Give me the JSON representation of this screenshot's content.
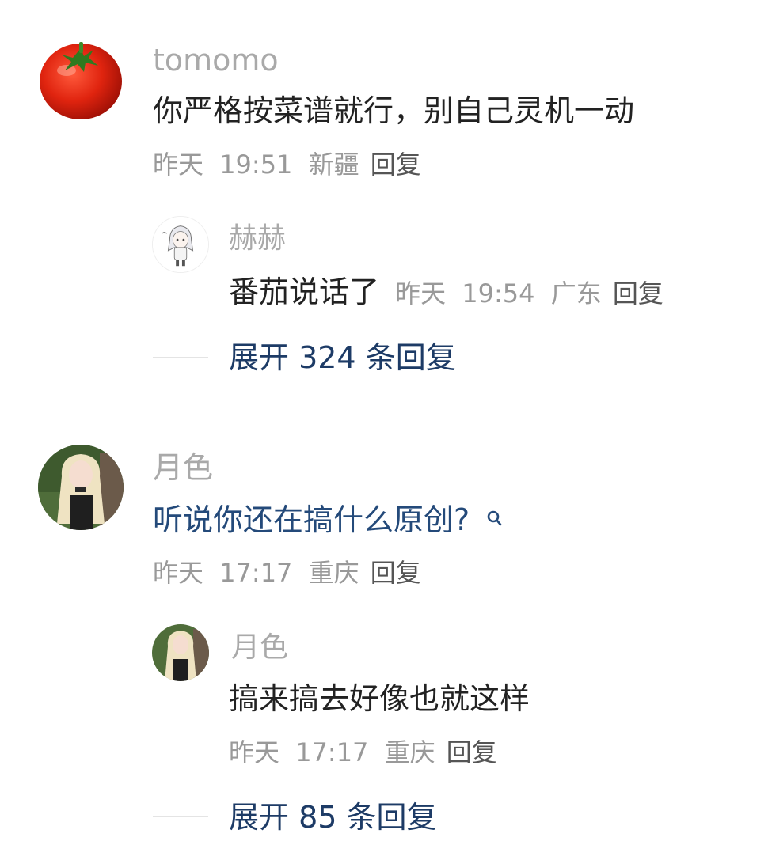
{
  "comments": [
    {
      "user": "tomomo",
      "text": "你严格按菜谱就行，别自己灵机一动",
      "date": "昨天",
      "time": "19:51",
      "location": "新疆",
      "reply_label": "回复",
      "replies": [
        {
          "user": "赫赫",
          "text": "番茄说话了",
          "date": "昨天",
          "time": "19:54",
          "location": "广东",
          "reply_label": "回复"
        }
      ],
      "expand": "展开 324 条回复"
    },
    {
      "user": "月色",
      "text": "听说你还在搞什么原创?",
      "search_icon": "search-icon",
      "date": "昨天",
      "time": "17:17",
      "location": "重庆",
      "reply_label": "回复",
      "replies": [
        {
          "user": "月色",
          "text": "搞来搞去好像也就这样",
          "date": "昨天",
          "time": "17:17",
          "location": "重庆",
          "reply_label": "回复"
        }
      ],
      "expand": "展开 85 条回复"
    }
  ],
  "colors": {
    "username": "#a9a9a9",
    "text": "#222222",
    "meta": "#999999",
    "link": "#1d3b66"
  }
}
